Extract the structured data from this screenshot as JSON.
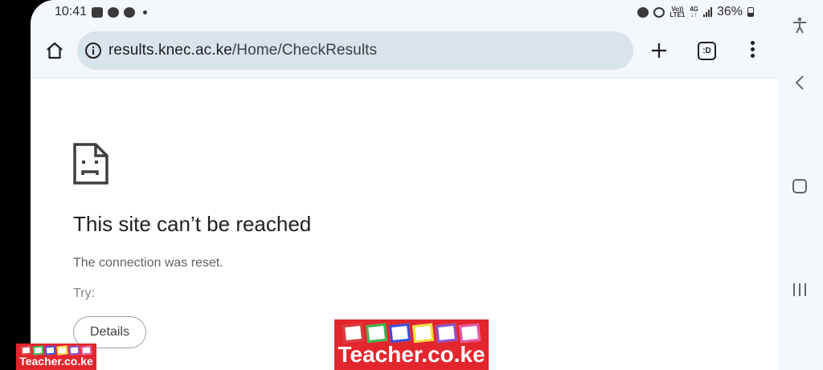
{
  "status_bar": {
    "time": "10:41",
    "network_top": "Vo))",
    "network_bottom": "LTE1",
    "gen_top": "4G",
    "gen_bottom": "↓↑",
    "battery": "36%"
  },
  "toolbar": {
    "url_host": "results.knec.ac.ke",
    "url_path": "/Home/CheckResults",
    "tab_switcher_label": ":D"
  },
  "error_page": {
    "title": "This site can’t be reached",
    "message": "The connection was reset.",
    "try_label": "Try:",
    "details_button": "Details"
  },
  "watermark": {
    "text": "Teacher.co.ke",
    "square_colors": [
      "#d93a3a",
      "#3cb44a",
      "#3b4bd6",
      "#f0e040",
      "#8a4fc9",
      "#e05aa8"
    ]
  },
  "icons": {
    "home": "home-icon",
    "info": "info-icon",
    "new_tab": "plus-icon",
    "menu": "more-vert-icon",
    "error": "sad-page-icon",
    "accessibility": "accessibility-icon",
    "back": "back-icon",
    "home_nav": "square-icon",
    "recents": "recents-icon"
  }
}
